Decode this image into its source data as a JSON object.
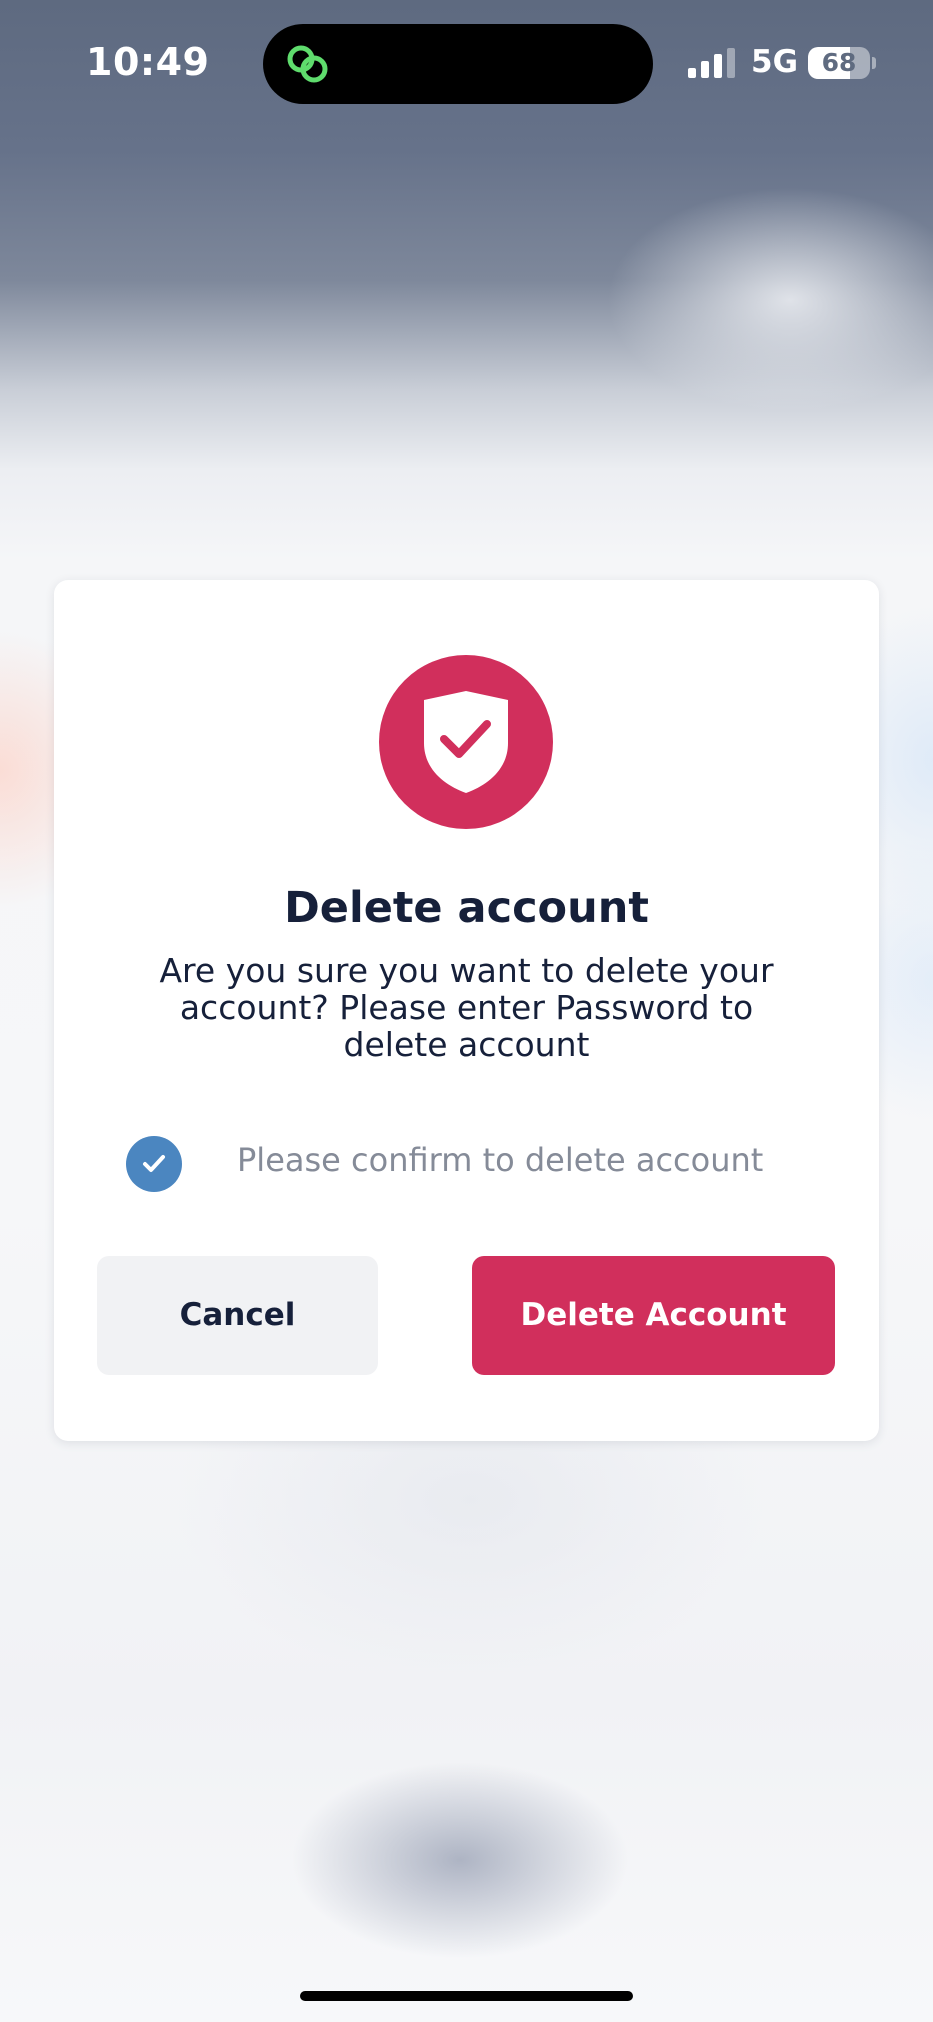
{
  "status_bar": {
    "time": "10:49",
    "network": "5G",
    "battery_level": "68",
    "battery_fraction": 0.68,
    "island_icon": "link-chain-icon",
    "island_icon_color": "#5fdc6d"
  },
  "dialog": {
    "icon": "shield-check-icon",
    "title": "Delete account",
    "message": "Are you sure you want to delete your account? Please enter Password to delete account",
    "confirm_checked": true,
    "confirm_label": "Please confirm to delete account",
    "cancel_label": "Cancel",
    "delete_label": "Delete Account"
  },
  "colors": {
    "accent": "#d12f5c",
    "check": "#4b86c0",
    "text_primary": "#16203a",
    "text_muted": "#858b98"
  }
}
